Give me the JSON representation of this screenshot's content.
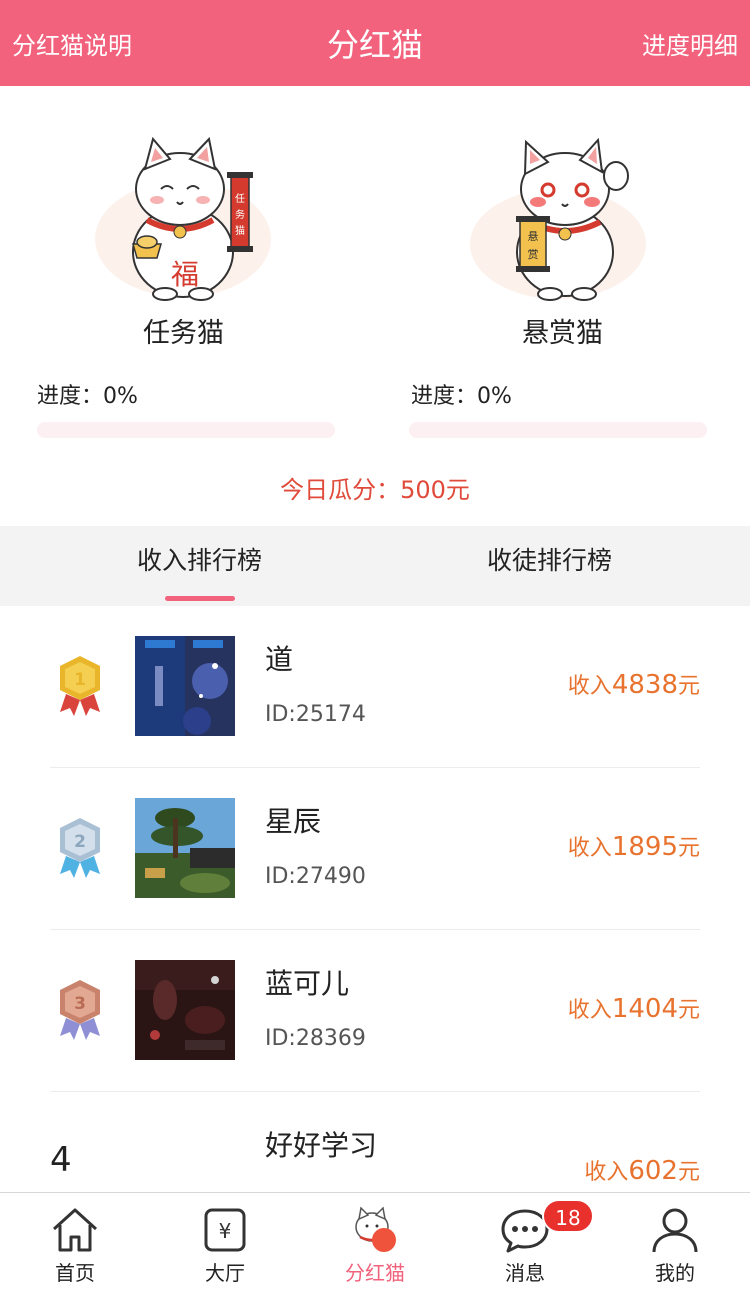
{
  "header": {
    "left_label": "分红猫说明",
    "title": "分红猫",
    "right_label": "进度明细"
  },
  "cats": [
    {
      "name": "任务猫",
      "progress_label": "进度：0%",
      "progress_value": 0
    },
    {
      "name": "悬赏猫",
      "progress_label": "进度：0%",
      "progress_value": 0
    }
  ],
  "today_label": "今日瓜分：500元",
  "tabs": [
    {
      "label": "收入排行榜",
      "active": true
    },
    {
      "label": "收徒排行榜",
      "active": false
    }
  ],
  "rank_list": [
    {
      "rank": "1",
      "name": "道",
      "id": "ID:25174",
      "income_prefix": "收入",
      "income_amount": "4838",
      "income_suffix": "元",
      "medal_color": "#e9b52a"
    },
    {
      "rank": "2",
      "name": "星辰",
      "id": "ID:27490",
      "income_prefix": "收入",
      "income_amount": "1895",
      "income_suffix": "元",
      "medal_color": "#a9bfd3"
    },
    {
      "rank": "3",
      "name": "蓝可儿",
      "id": "ID:28369",
      "income_prefix": "收入",
      "income_amount": "1404",
      "income_suffix": "元",
      "medal_color": "#c9836c"
    },
    {
      "rank": "4",
      "name": "好好学习",
      "id": "",
      "income_prefix": "收入",
      "income_amount": "602",
      "income_suffix": "元"
    }
  ],
  "tabbar": [
    {
      "label": "首页",
      "icon": "home-icon",
      "active": false
    },
    {
      "label": "大厅",
      "icon": "yuan-icon",
      "active": false
    },
    {
      "label": "分红猫",
      "icon": "lucky-cat-icon",
      "active": true
    },
    {
      "label": "消息",
      "icon": "chat-icon",
      "active": false,
      "badge": "18"
    },
    {
      "label": "我的",
      "icon": "user-icon",
      "active": false
    }
  ],
  "colors": {
    "brand": "#f2627c",
    "income": "#e8732f",
    "today": "#e04a3a",
    "badge": "#e8302c"
  }
}
